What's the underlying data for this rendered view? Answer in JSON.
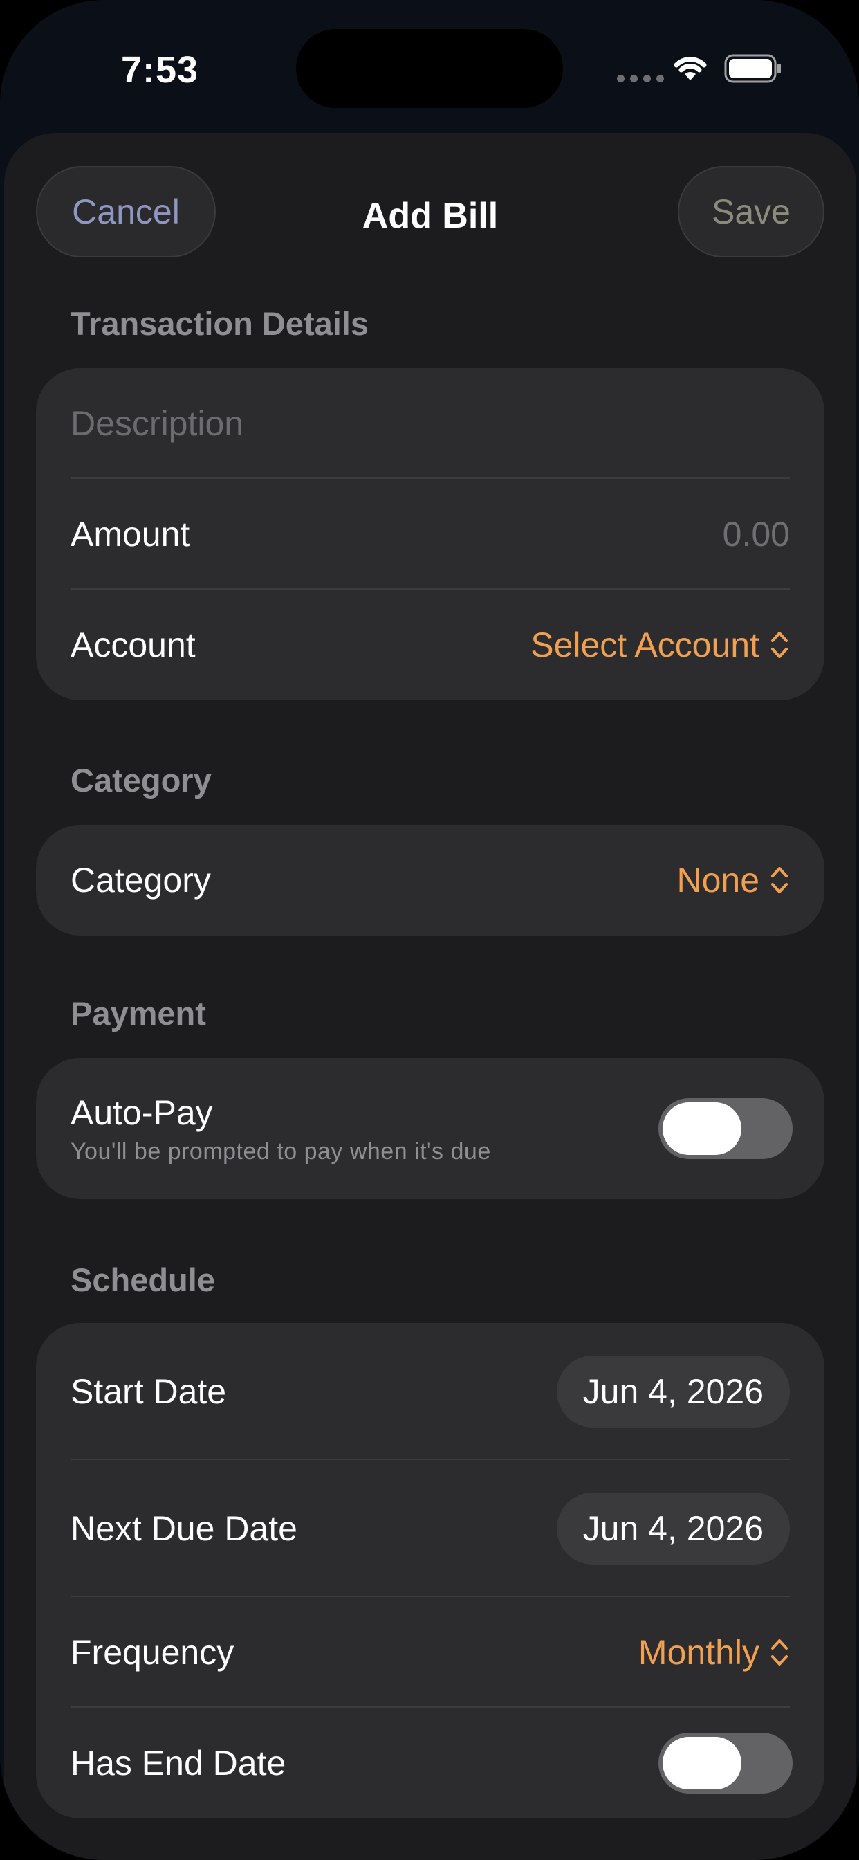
{
  "status_bar": {
    "time": "7:53"
  },
  "nav": {
    "cancel_label": "Cancel",
    "title": "Add Bill",
    "save_label": "Save"
  },
  "transaction": {
    "header": "Transaction Details",
    "description_placeholder": "Description",
    "amount_label": "Amount",
    "amount_placeholder": "0.00",
    "account_label": "Account",
    "account_value": "Select Account"
  },
  "category": {
    "header": "Category",
    "label": "Category",
    "value": "None"
  },
  "payment": {
    "header": "Payment",
    "autopay_label": "Auto-Pay",
    "autopay_subtitle": "You'll be prompted to pay when it's due",
    "autopay_on": false
  },
  "schedule": {
    "header": "Schedule",
    "start_date_label": "Start Date",
    "start_date_value": "Jun 4, 2026",
    "next_due_label": "Next Due Date",
    "next_due_value": "Jun 4, 2026",
    "frequency_label": "Frequency",
    "frequency_value": "Monthly",
    "has_end_date_label": "Has End Date",
    "has_end_date_on": false
  },
  "colors": {
    "accent": "#f0a050",
    "cancel_text": "#8e96c2",
    "card_bg": "#2c2c2e",
    "sheet_bg": "#1c1c1e"
  },
  "icons": [
    "wifi-icon",
    "battery-icon",
    "chevron-updown-icon"
  ]
}
